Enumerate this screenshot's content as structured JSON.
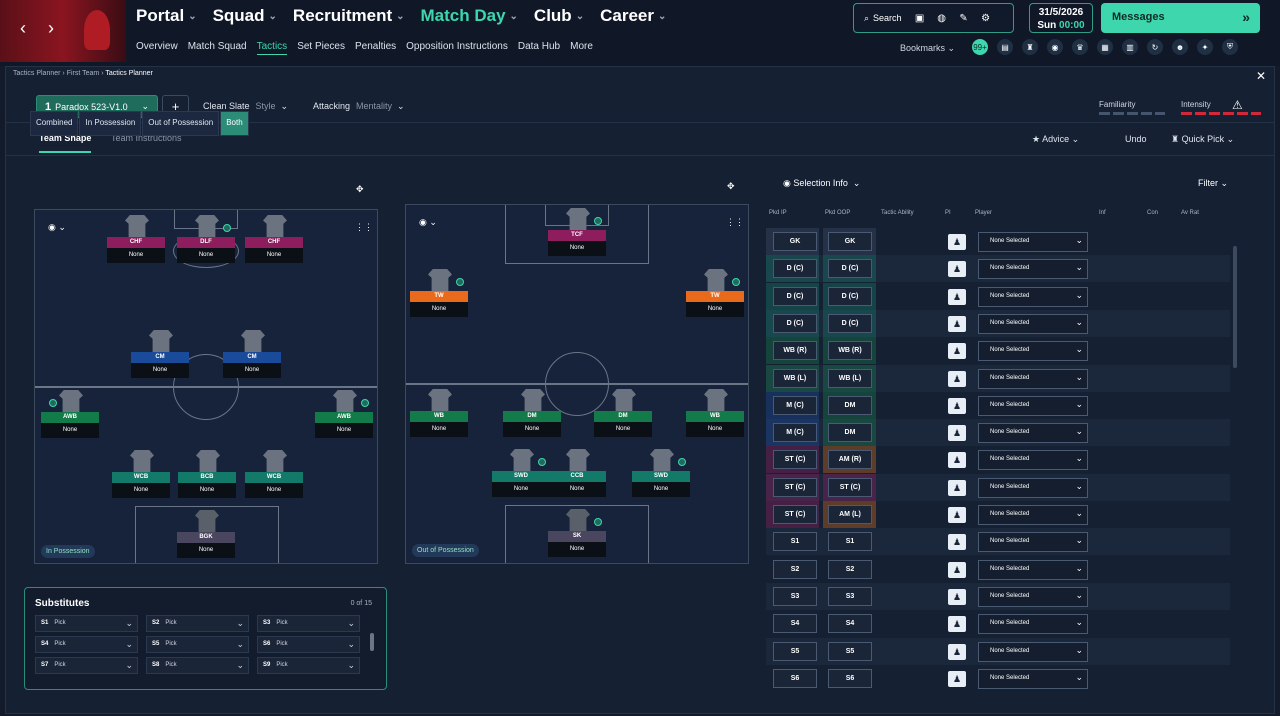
{
  "nav": {
    "back": "‹",
    "forward": "›",
    "items": [
      "Portal",
      "Squad",
      "Recruitment",
      "Match Day",
      "Club",
      "Career"
    ],
    "active": "Match Day"
  },
  "subnav": [
    "Overview",
    "Match Squad",
    "Tactics",
    "Set Pieces",
    "Penalties",
    "Opposition Instructions",
    "Data Hub",
    "More"
  ],
  "subnav_active": "Tactics",
  "tools": {
    "search": "Search"
  },
  "date": {
    "day": "31/5/2026",
    "weekday": "Sun",
    "time": "00:00"
  },
  "messages": "Messages",
  "bookmarks": "Bookmarks",
  "badge_count": "99+",
  "breadcrumb": [
    "Tactics Planner",
    "First Team",
    "Tactics Planner"
  ],
  "tactic": {
    "num": "1",
    "name": "Paradox 523-V1.0",
    "style_value": "Clean Slate",
    "style_label": "Style",
    "mentality_value": "Attacking",
    "mentality_label": "Mentality"
  },
  "familiarity": "Familiarity",
  "intensity": "Intensity",
  "tabs": [
    "Team Shape",
    "Team Instructions"
  ],
  "right_tabs": {
    "advice": "Advice",
    "undo": "Undo",
    "quick_pick": "Quick Pick"
  },
  "segments": [
    "Combined",
    "In Possession",
    "Out of Possession",
    "Both"
  ],
  "segment_active": "Both",
  "pitch_ip": {
    "phase": "In Possession",
    "players": [
      {
        "role": "CHF",
        "name": "None",
        "color": "#8e1d5e"
      },
      {
        "role": "DLF",
        "name": "None",
        "color": "#8e1d5e"
      },
      {
        "role": "CHF",
        "name": "None",
        "color": "#8e1d5e"
      },
      {
        "role": "CM",
        "name": "None",
        "color": "#1a4a9a"
      },
      {
        "role": "CM",
        "name": "None",
        "color": "#1a4a9a"
      },
      {
        "role": "AWB",
        "name": "None",
        "color": "#137a4a"
      },
      {
        "role": "AWB",
        "name": "None",
        "color": "#137a4a"
      },
      {
        "role": "WCB",
        "name": "None",
        "color": "#137a6a"
      },
      {
        "role": "BCB",
        "name": "None",
        "color": "#137a6a"
      },
      {
        "role": "WCB",
        "name": "None",
        "color": "#137a6a"
      },
      {
        "role": "BGK",
        "name": "None",
        "color": "#4a4660"
      }
    ]
  },
  "pitch_oop": {
    "phase": "Out of Possession",
    "players": [
      {
        "role": "TCF",
        "name": "None",
        "color": "#8e1d5e"
      },
      {
        "role": "TW",
        "name": "None",
        "color": "#e86a1a"
      },
      {
        "role": "TW",
        "name": "None",
        "color": "#e86a1a"
      },
      {
        "role": "WB",
        "name": "None",
        "color": "#137a4a"
      },
      {
        "role": "DM",
        "name": "None",
        "color": "#137a4a"
      },
      {
        "role": "DM",
        "name": "None",
        "color": "#137a4a"
      },
      {
        "role": "WB",
        "name": "None",
        "color": "#137a4a"
      },
      {
        "role": "SWD",
        "name": "None",
        "color": "#137a6a"
      },
      {
        "role": "CCB",
        "name": "None",
        "color": "#137a6a"
      },
      {
        "role": "SWD",
        "name": "None",
        "color": "#137a6a"
      },
      {
        "role": "SK",
        "name": "None",
        "color": "#4a4660"
      }
    ]
  },
  "substitutes": {
    "title": "Substitutes",
    "count": "0 of 15",
    "pick": "Pick",
    "slots": [
      "S1",
      "S2",
      "S3",
      "S4",
      "S5",
      "S6",
      "S7",
      "S8",
      "S9"
    ]
  },
  "selection": {
    "info": "Selection Info",
    "filter": "Filter",
    "headers": [
      "Pkd IP",
      "Pkd OOP",
      "Tactic Ability",
      "PI",
      "Player",
      "Inf",
      "Con",
      "Av Rat"
    ],
    "none_selected": "None Selected",
    "rows": [
      {
        "ip": "GK",
        "oop": "GK",
        "ipc": "#3a4a66",
        "oopc": "#3a4a66"
      },
      {
        "ip": "D (C)",
        "oop": "D (C)",
        "ipc": "#137a6a",
        "oopc": "#137a6a"
      },
      {
        "ip": "D (C)",
        "oop": "D (C)",
        "ipc": "#137a6a",
        "oopc": "#137a6a"
      },
      {
        "ip": "D (C)",
        "oop": "D (C)",
        "ipc": "#137a6a",
        "oopc": "#137a6a"
      },
      {
        "ip": "WB (R)",
        "oop": "WB (R)",
        "ipc": "#137a4a",
        "oopc": "#137a4a"
      },
      {
        "ip": "WB (L)",
        "oop": "WB (L)",
        "ipc": "#137a4a",
        "oopc": "#137a4a"
      },
      {
        "ip": "M (C)",
        "oop": "DM",
        "ipc": "#1a4a9a",
        "oopc": "#137a4a"
      },
      {
        "ip": "M (C)",
        "oop": "DM",
        "ipc": "#1a4a9a",
        "oopc": "#137a4a"
      },
      {
        "ip": "ST (C)",
        "oop": "AM (R)",
        "ipc": "#8e1d5e",
        "oopc": "#c86a1a"
      },
      {
        "ip": "ST (C)",
        "oop": "ST (C)",
        "ipc": "#8e1d5e",
        "oopc": "#8e1d5e"
      },
      {
        "ip": "ST (C)",
        "oop": "AM (L)",
        "ipc": "#8e1d5e",
        "oopc": "#c86a1a"
      },
      {
        "ip": "S1",
        "oop": "S1",
        "ipc": "",
        "oopc": ""
      },
      {
        "ip": "S2",
        "oop": "S2",
        "ipc": "",
        "oopc": ""
      },
      {
        "ip": "S3",
        "oop": "S3",
        "ipc": "",
        "oopc": ""
      },
      {
        "ip": "S4",
        "oop": "S4",
        "ipc": "",
        "oopc": ""
      },
      {
        "ip": "S5",
        "oop": "S5",
        "ipc": "",
        "oopc": ""
      },
      {
        "ip": "S6",
        "oop": "S6",
        "ipc": "",
        "oopc": ""
      }
    ]
  }
}
